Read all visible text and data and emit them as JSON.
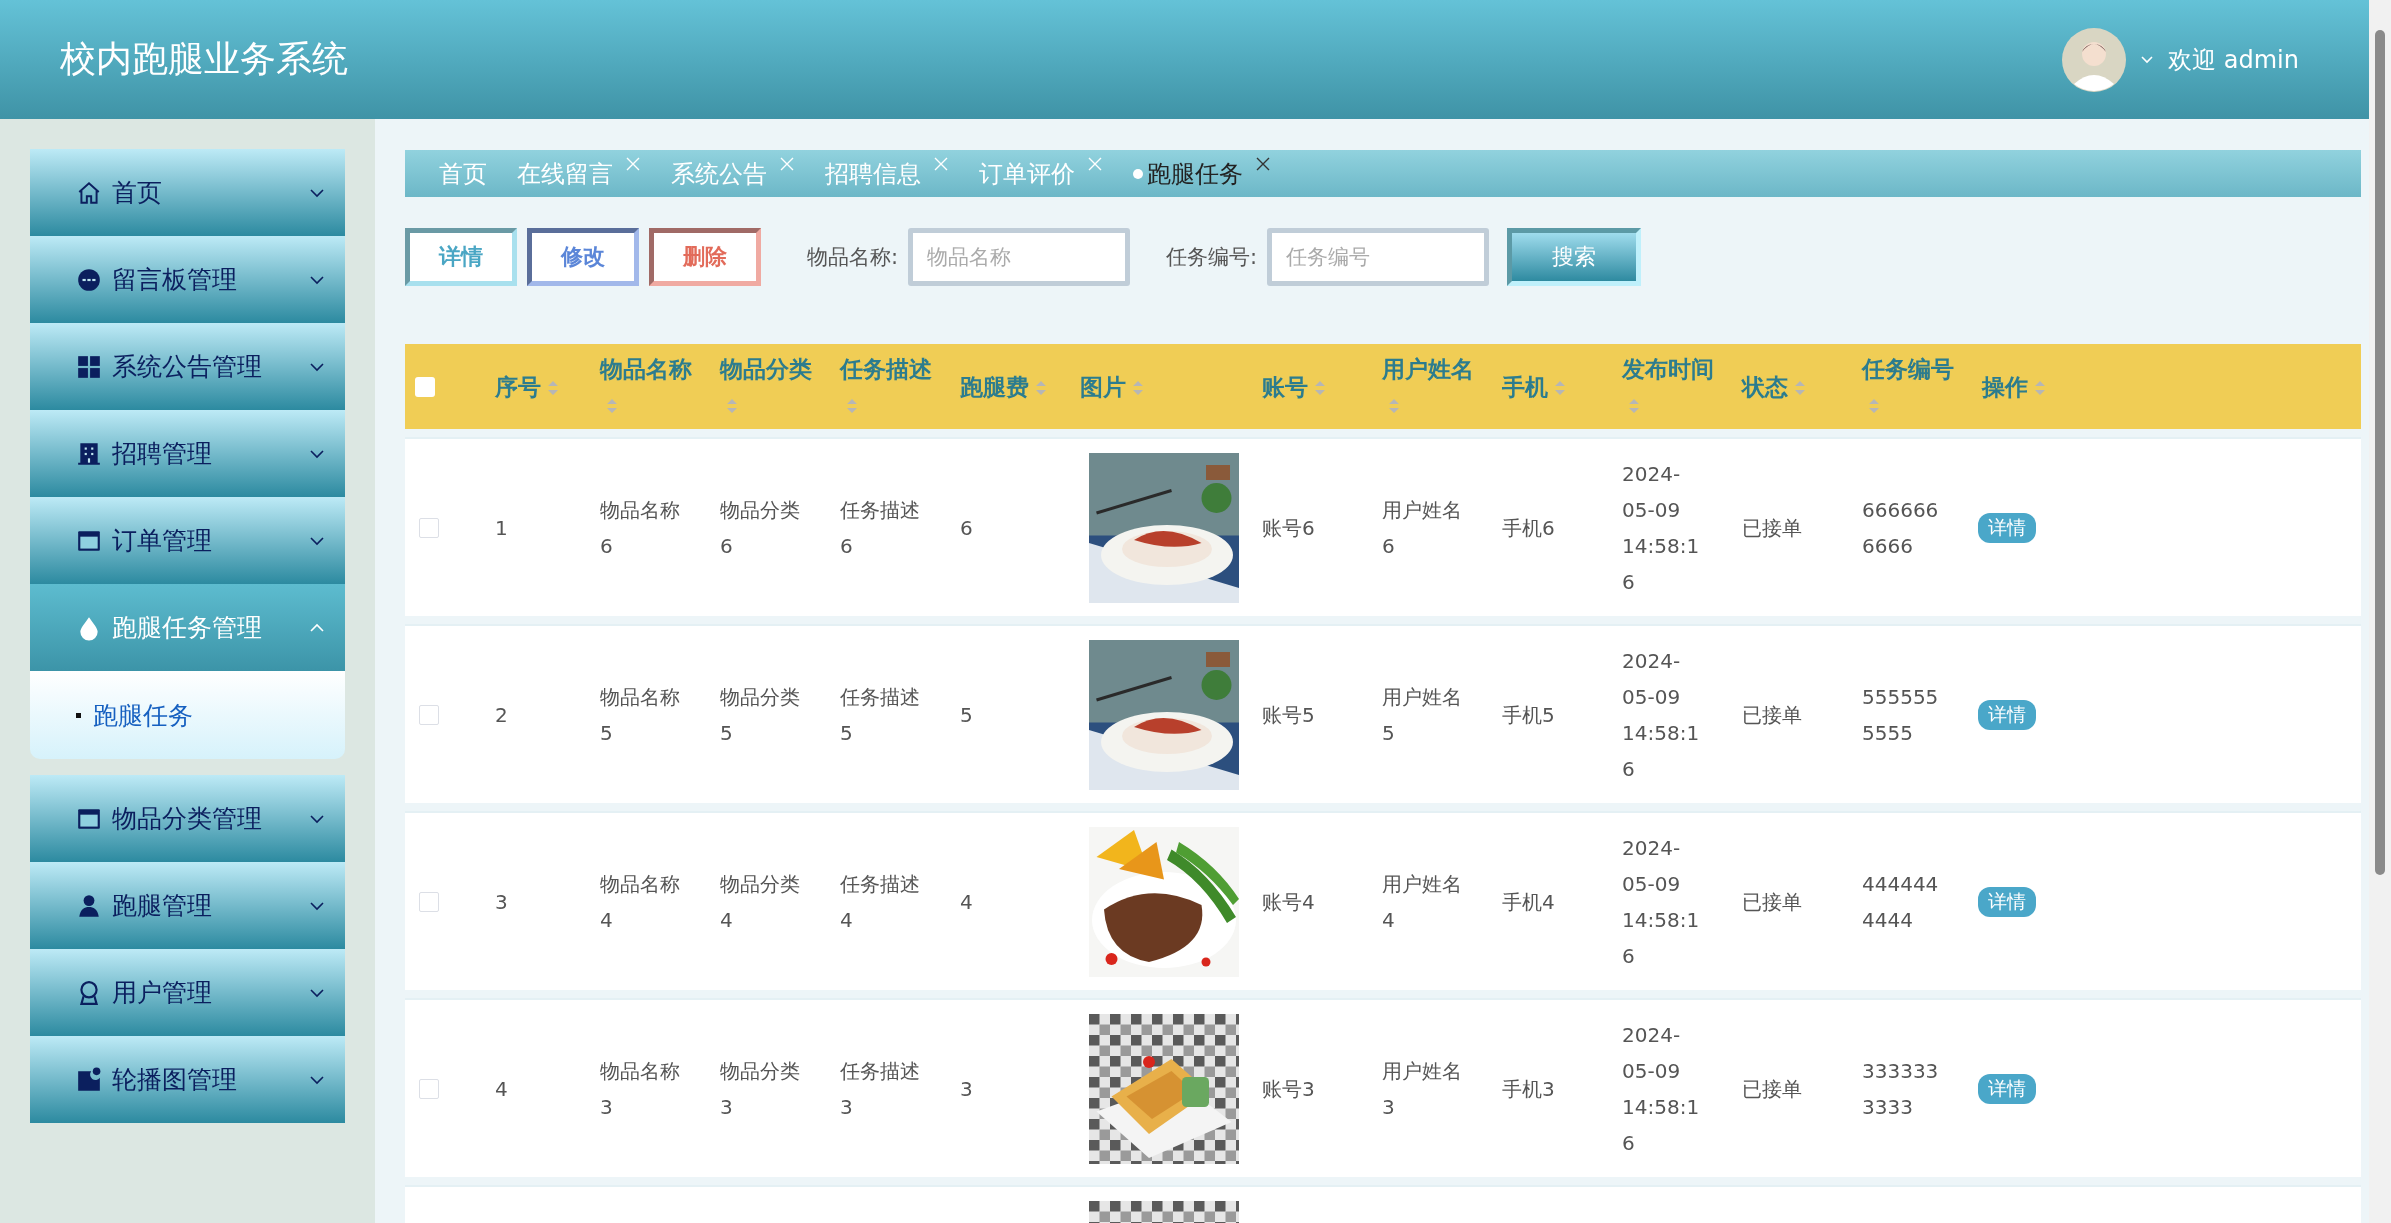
{
  "header": {
    "title": "校内跑腿业务系统",
    "welcome": "欢迎 admin"
  },
  "sidebar": {
    "items": [
      {
        "label": "首页",
        "expanded": false
      },
      {
        "label": "留言板管理",
        "expanded": false
      },
      {
        "label": "系统公告管理",
        "expanded": false
      },
      {
        "label": "招聘管理",
        "expanded": false
      },
      {
        "label": "订单管理",
        "expanded": false
      },
      {
        "label": "跑腿任务管理",
        "expanded": true,
        "children": [
          {
            "label": "跑腿任务",
            "selected": true
          }
        ]
      },
      {
        "label": "物品分类管理",
        "expanded": false
      },
      {
        "label": "跑腿管理",
        "expanded": false
      },
      {
        "label": "用户管理",
        "expanded": false
      },
      {
        "label": "轮播图管理",
        "expanded": false
      }
    ]
  },
  "tabs": [
    {
      "label": "首页",
      "closable": false,
      "selected": false
    },
    {
      "label": "在线留言",
      "closable": true,
      "selected": false
    },
    {
      "label": "系统公告",
      "closable": true,
      "selected": false
    },
    {
      "label": "招聘信息",
      "closable": true,
      "selected": false
    },
    {
      "label": "订单评价",
      "closable": true,
      "selected": false
    },
    {
      "label": "跑腿任务",
      "closable": true,
      "selected": true
    }
  ],
  "toolbar": {
    "buttons": [
      {
        "label": "详情",
        "kind": "detail"
      },
      {
        "label": "修改",
        "kind": "edit"
      },
      {
        "label": "删除",
        "kind": "delete"
      }
    ],
    "filters": [
      {
        "label": "物品名称:",
        "placeholder": "物品名称"
      },
      {
        "label": "任务编号:",
        "placeholder": "任务编号"
      }
    ],
    "search_button": "搜索"
  },
  "table": {
    "select_all": {
      "checked": false
    },
    "columns": [
      "序号",
      "物品名称",
      "物品分类",
      "任务描述",
      "跑腿费",
      "图片",
      "账号",
      "用户姓名",
      "手机",
      "发布时间",
      "状态",
      "任务编号",
      "操作"
    ],
    "rows": [
      {
        "checked": false,
        "cells": [
          "1",
          "物品名称6",
          "物品分类6",
          "任务描述6",
          "6",
          null,
          "账号6",
          "用户姓名6",
          "手机6",
          "2024-05-09 14:58:16",
          "已接单",
          "6666666666"
        ],
        "image": {
          "kind": "picture"
        },
        "action": "详情"
      },
      {
        "checked": false,
        "cells": [
          "2",
          "物品名称5",
          "物品分类5",
          "任务描述5",
          "5",
          null,
          "账号5",
          "用户姓名5",
          "手机5",
          "2024-05-09 14:58:16",
          "已接单",
          "5555555555"
        ],
        "image": {
          "kind": "picture"
        },
        "action": "详情"
      },
      {
        "checked": false,
        "cells": [
          "3",
          "物品名称4",
          "物品分类4",
          "任务描述4",
          "4",
          null,
          "账号4",
          "用户姓名4",
          "手机4",
          "2024-05-09 14:58:16",
          "已接单",
          "4444444444"
        ],
        "image": {
          "kind": "picture"
        },
        "action": "详情"
      },
      {
        "checked": false,
        "cells": [
          "4",
          "物品名称3",
          "物品分类3",
          "任务描述3",
          "3",
          null,
          "账号3",
          "用户姓名3",
          "手机3",
          "2024-05-09 14:58:16",
          "已接单",
          "3333333333"
        ],
        "image": {
          "kind": "picture"
        },
        "action": "详情"
      },
      {
        "image": {
          "kind": "picture"
        }
      }
    ]
  }
}
